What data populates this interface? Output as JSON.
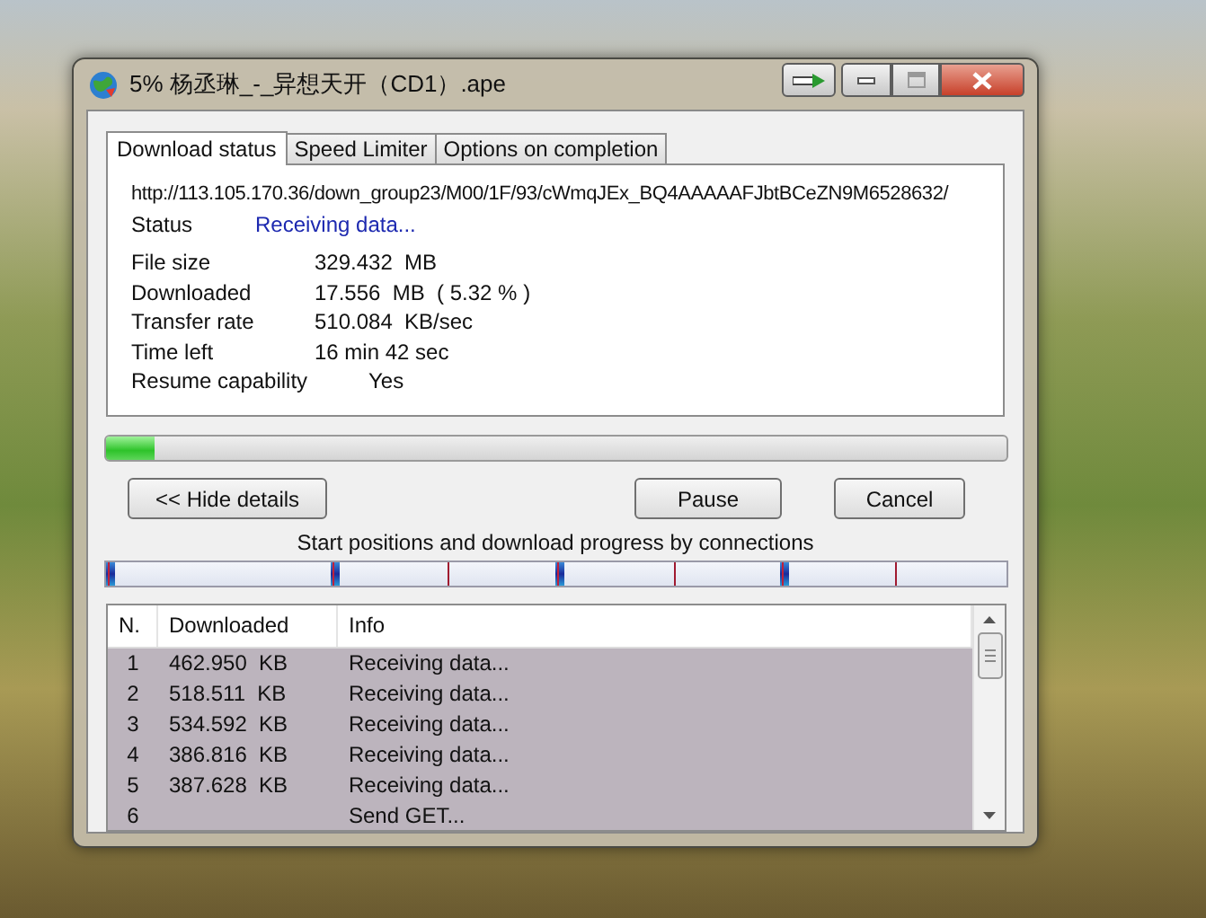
{
  "window": {
    "title": "5% 杨丞琳_-_异想天开（CD1）.ape"
  },
  "tabs": [
    {
      "label": "Download status",
      "selected": true
    },
    {
      "label": "Speed Limiter",
      "selected": false
    },
    {
      "label": "Options on completion",
      "selected": false
    }
  ],
  "url": "http://113.105.170.36/down_group23/M00/1F/93/cWmqJEx_BQ4AAAAAFJbtBCeZN9M6528632/",
  "status": {
    "label": "Status",
    "value": "Receiving data..."
  },
  "details": [
    {
      "label": "File size",
      "value": "329.432  MB"
    },
    {
      "label": "Downloaded",
      "value": "17.556  MB  ( 5.32 % )"
    },
    {
      "label": "Transfer rate",
      "value": "510.084  KB/sec"
    },
    {
      "label": "Time left",
      "value": "16 min 42 sec"
    },
    {
      "label": "Resume capability",
      "value": "Yes",
      "kind": "indented"
    }
  ],
  "progress": {
    "level": 0.0532
  },
  "buttons": {
    "hide_details": "<< Hide details",
    "pause": "Pause",
    "cancel": "Cancel"
  },
  "connections_caption": "Start positions and download progress by connections",
  "table": {
    "columns": [
      "N.",
      "Downloaded",
      "Info"
    ],
    "rows": [
      {
        "n": "1",
        "downloaded": "462.950  KB",
        "info": "Receiving data...",
        "selected": true
      },
      {
        "n": "2",
        "downloaded": "518.511  KB",
        "info": "Receiving data...",
        "selected": true
      },
      {
        "n": "3",
        "downloaded": "534.592  KB",
        "info": "Receiving data...",
        "selected": true
      },
      {
        "n": "4",
        "downloaded": "386.816  KB",
        "info": "Receiving data...",
        "selected": true
      },
      {
        "n": "5",
        "downloaded": "387.628  KB",
        "info": "Receiving data...",
        "selected": true
      },
      {
        "n": "6",
        "info": "Send GET...",
        "selected": true
      }
    ]
  }
}
